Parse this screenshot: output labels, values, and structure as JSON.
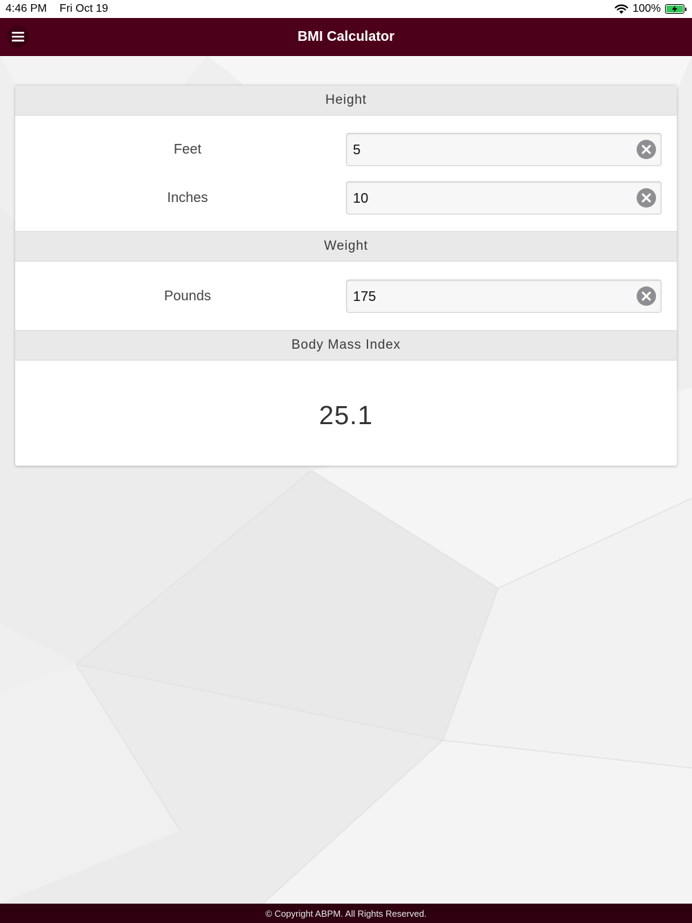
{
  "status_bar": {
    "time": "4:46 PM",
    "date": "Fri Oct 19",
    "battery_percent": "100%",
    "battery_level": 1.0
  },
  "header": {
    "title": "BMI Calculator",
    "menu_icon": "hamburger-menu-icon"
  },
  "height_section": {
    "title": "Height",
    "feet_label": "Feet",
    "feet_value": "5",
    "inches_label": "Inches",
    "inches_value": "10"
  },
  "weight_section": {
    "title": "Weight",
    "pounds_label": "Pounds",
    "pounds_value": "175"
  },
  "result_section": {
    "title": "Body Mass Index",
    "bmi_value": "25.1"
  },
  "footer": {
    "copyright": "© Copyright ABPM. All Rights Reserved."
  },
  "colors": {
    "nav_bar": "#4d0019",
    "footer": "#2e0010",
    "section_header": "#e9e9e9"
  }
}
